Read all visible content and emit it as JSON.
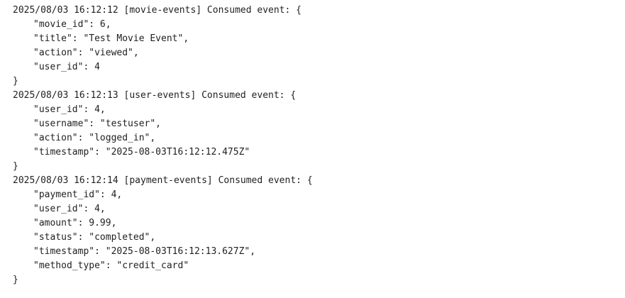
{
  "log_lines": [
    {
      "text": "2025/08/03 16:12:12 [movie-events] Consumed event: {",
      "indent": false
    },
    {
      "text": "\"movie_id\": 6,",
      "indent": true
    },
    {
      "text": "\"title\": \"Test Movie Event\",",
      "indent": true
    },
    {
      "text": "\"action\": \"viewed\",",
      "indent": true
    },
    {
      "text": "\"user_id\": 4",
      "indent": true
    },
    {
      "text": "}",
      "indent": false
    },
    {
      "text": "2025/08/03 16:12:13 [user-events] Consumed event: {",
      "indent": false
    },
    {
      "text": "\"user_id\": 4,",
      "indent": true
    },
    {
      "text": "\"username\": \"testuser\",",
      "indent": true
    },
    {
      "text": "\"action\": \"logged_in\",",
      "indent": true
    },
    {
      "text": "\"timestamp\": \"2025-08-03T16:12:12.475Z\"",
      "indent": true
    },
    {
      "text": "}",
      "indent": false
    },
    {
      "text": "2025/08/03 16:12:14 [payment-events] Consumed event: {",
      "indent": false
    },
    {
      "text": "\"payment_id\": 4,",
      "indent": true
    },
    {
      "text": "\"user_id\": 4,",
      "indent": true
    },
    {
      "text": "\"amount\": 9.99,",
      "indent": true
    },
    {
      "text": "\"status\": \"completed\",",
      "indent": true
    },
    {
      "text": "\"timestamp\": \"2025-08-03T16:12:13.627Z\",",
      "indent": true
    },
    {
      "text": "\"method_type\": \"credit_card\"",
      "indent": true
    },
    {
      "text": "}",
      "indent": false
    }
  ]
}
